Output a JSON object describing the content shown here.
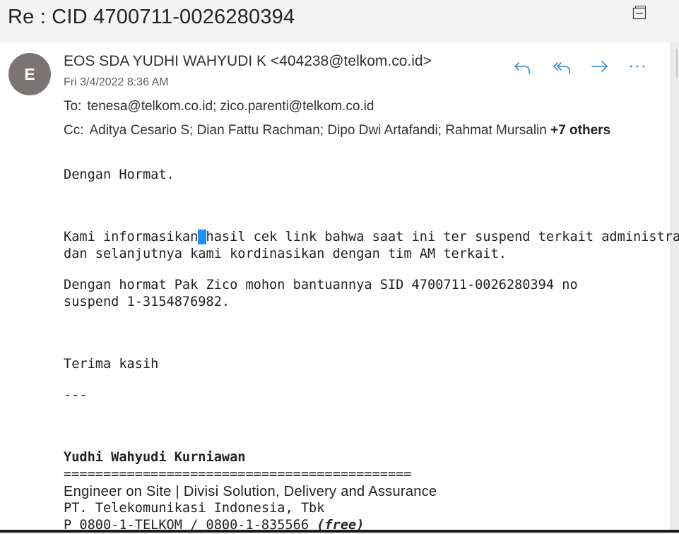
{
  "subject": "Re : CID 4700711-0026280394",
  "sender": {
    "initial": "E",
    "display": "EOS SDA YUDHI WAHYUDI K <404238@telkom.co.id>",
    "date": "Fri 3/4/2022 8:36 AM"
  },
  "recipients": {
    "to_label": "To:",
    "to": "tenesa@telkom.co.id; zico.parenti@telkom.co.id",
    "cc_label": "Cc:",
    "cc": "Aditya Cesario S; Dian Fattu Rachman; Dipo Dwi Artafandi; Rahmat Mursalin",
    "cc_more": "+7 others"
  },
  "actions": {
    "reply_icon": "reply-icon",
    "reply_all_icon": "reply-all-icon",
    "forward_icon": "forward-icon",
    "more_icon": "more-icon"
  },
  "body": {
    "greeting": "Dengan Hormat.",
    "p1_a": "Kami informasikan",
    "p1_b": "hasil cek link bahwa saat ini ter suspend terkait administrasi,",
    "p1_line2": "dan selanjutnya kami kordinasikan dengan tim AM terkait.",
    "p2_line1": "Dengan hormat Pak Zico mohon bantuannya SID 4700711-0026280394 no",
    "p2_line2": "suspend 1-3154876982.",
    "closing": "Terima kasih",
    "separator": "---"
  },
  "signature": {
    "name": "Yudhi Wahyudi Kurniawan",
    "rule": "============================================",
    "title": "Engineer on Site | Divisi Solution, Delivery and Assurance",
    "company": "PT. Telekomunikasi Indonesia, Tbk",
    "phone": "P 0800-1-TELKOM / 0800-1-835566",
    "phone_note": "(free)"
  },
  "colors": {
    "accent": "#2b88d8",
    "avatar_bg": "#7a7574",
    "page_bg": "#f4f4f4"
  }
}
